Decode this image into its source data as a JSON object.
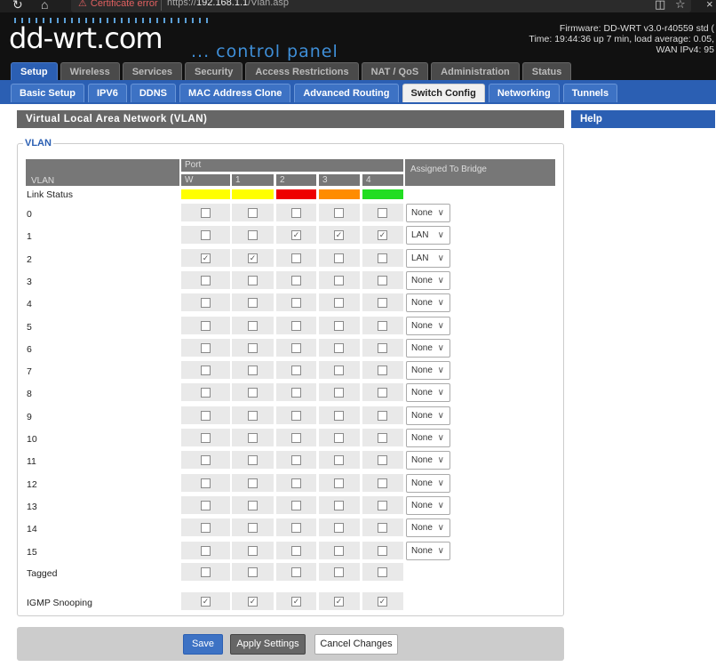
{
  "browser": {
    "cert_error": "Certificate error",
    "url_prefix": "https://",
    "url_host": "192.168.1.1",
    "url_path": "/Vlan.asp"
  },
  "header": {
    "logo": "dd-wrt.com",
    "subtitle": "... control panel",
    "firmware": "Firmware: DD-WRT v3.0-r40559 std (",
    "time": "Time: 19:44:36 up 7 min, load average: 0.05,",
    "wan": "WAN IPv4: 95"
  },
  "main_tabs": [
    {
      "label": "Setup",
      "active": true
    },
    {
      "label": "Wireless"
    },
    {
      "label": "Services"
    },
    {
      "label": "Security"
    },
    {
      "label": "Access Restrictions"
    },
    {
      "label": "NAT / QoS"
    },
    {
      "label": "Administration"
    },
    {
      "label": "Status"
    }
  ],
  "sub_tabs": [
    {
      "label": "Basic Setup"
    },
    {
      "label": "IPV6"
    },
    {
      "label": "DDNS"
    },
    {
      "label": "MAC Address Clone"
    },
    {
      "label": "Advanced Routing"
    },
    {
      "label": "Switch Config",
      "active": true
    },
    {
      "label": "Networking"
    },
    {
      "label": "Tunnels"
    }
  ],
  "section_title": "Virtual Local Area Network (VLAN)",
  "help_title": "Help",
  "fieldset_legend": "VLAN",
  "table": {
    "vlan_header": "VLAN",
    "port_header": "Port",
    "ports": [
      "W",
      "1",
      "2",
      "3",
      "4"
    ],
    "assigned_header": "Assigned To Bridge",
    "link_status_label": "Link Status",
    "link_colors": [
      "#ffff00",
      "#ffff00",
      "#ee0000",
      "#ff8c00",
      "#22dd22"
    ],
    "rows": [
      {
        "label": "0",
        "checked": [
          false,
          false,
          false,
          false,
          false
        ],
        "bridge": "None"
      },
      {
        "label": "1",
        "checked": [
          false,
          false,
          true,
          true,
          true
        ],
        "bridge": "LAN"
      },
      {
        "label": "2",
        "checked": [
          true,
          true,
          false,
          false,
          false
        ],
        "bridge": "LAN"
      },
      {
        "label": "3",
        "checked": [
          false,
          false,
          false,
          false,
          false
        ],
        "bridge": "None"
      },
      {
        "label": "4",
        "checked": [
          false,
          false,
          false,
          false,
          false
        ],
        "bridge": "None"
      },
      {
        "label": "5",
        "checked": [
          false,
          false,
          false,
          false,
          false
        ],
        "bridge": "None"
      },
      {
        "label": "6",
        "checked": [
          false,
          false,
          false,
          false,
          false
        ],
        "bridge": "None"
      },
      {
        "label": "7",
        "checked": [
          false,
          false,
          false,
          false,
          false
        ],
        "bridge": "None"
      },
      {
        "label": "8",
        "checked": [
          false,
          false,
          false,
          false,
          false
        ],
        "bridge": "None"
      },
      {
        "label": "9",
        "checked": [
          false,
          false,
          false,
          false,
          false
        ],
        "bridge": "None"
      },
      {
        "label": "10",
        "checked": [
          false,
          false,
          false,
          false,
          false
        ],
        "bridge": "None"
      },
      {
        "label": "11",
        "checked": [
          false,
          false,
          false,
          false,
          false
        ],
        "bridge": "None"
      },
      {
        "label": "12",
        "checked": [
          false,
          false,
          false,
          false,
          false
        ],
        "bridge": "None"
      },
      {
        "label": "13",
        "checked": [
          false,
          false,
          false,
          false,
          false
        ],
        "bridge": "None"
      },
      {
        "label": "14",
        "checked": [
          false,
          false,
          false,
          false,
          false
        ],
        "bridge": "None"
      },
      {
        "label": "15",
        "checked": [
          false,
          false,
          false,
          false,
          false
        ],
        "bridge": "None"
      }
    ],
    "tagged": {
      "label": "Tagged",
      "checked": [
        false,
        false,
        false,
        false,
        false
      ]
    },
    "igmp": {
      "label": "IGMP Snooping",
      "checked": [
        true,
        true,
        true,
        true,
        true
      ]
    }
  },
  "buttons": {
    "save": "Save",
    "apply": "Apply Settings",
    "cancel": "Cancel Changes"
  }
}
